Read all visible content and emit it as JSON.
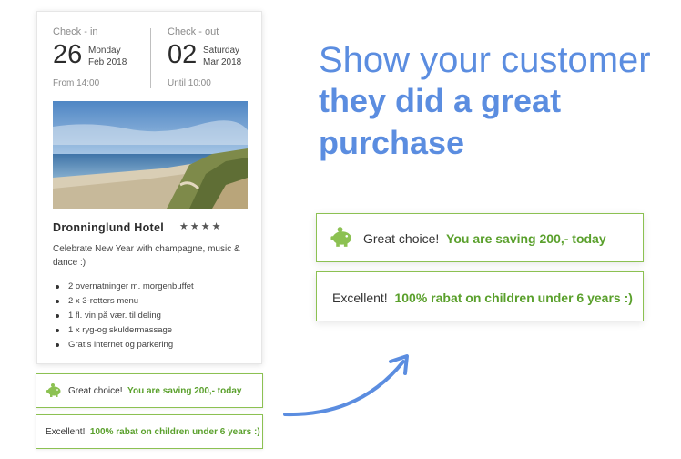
{
  "checkin": {
    "label": "Check - in",
    "day": "26",
    "weekday": "Monday",
    "month_year": "Feb 2018",
    "time": "From 14:00"
  },
  "checkout": {
    "label": "Check - out",
    "day": "02",
    "weekday": "Saturday",
    "month_year": "Mar 2018",
    "time": "Until 10:00"
  },
  "hotel": {
    "name": "Dronninglund Hotel",
    "stars": "★★★★",
    "rating": 4,
    "description": "Celebrate New Year with champagne, music & dance :)",
    "amenities": [
      "2 overnatninger m. morgenbuffet",
      "2 x 3-retters menu",
      "1 fl. vin på vær. til deling",
      "1 x ryg-og skuldermassage",
      "Gratis internet og parkering"
    ]
  },
  "notes": {
    "choice_prefix": "Great choice!",
    "choice_highlight": "You are saving 200,- today",
    "excellent_prefix": "Excellent!",
    "excellent_highlight": "100% rabat on children under 6 years :)"
  },
  "headline": {
    "line1": "Show your customer",
    "line2": "they did a great",
    "line3": "purchase"
  },
  "colors": {
    "accent_blue": "#5b8de0",
    "success_green": "#5aa02c",
    "border_green": "#8cc152"
  },
  "icons": {
    "piggy_bank": "piggy-bank-icon",
    "arrow": "curved-arrow-icon"
  }
}
